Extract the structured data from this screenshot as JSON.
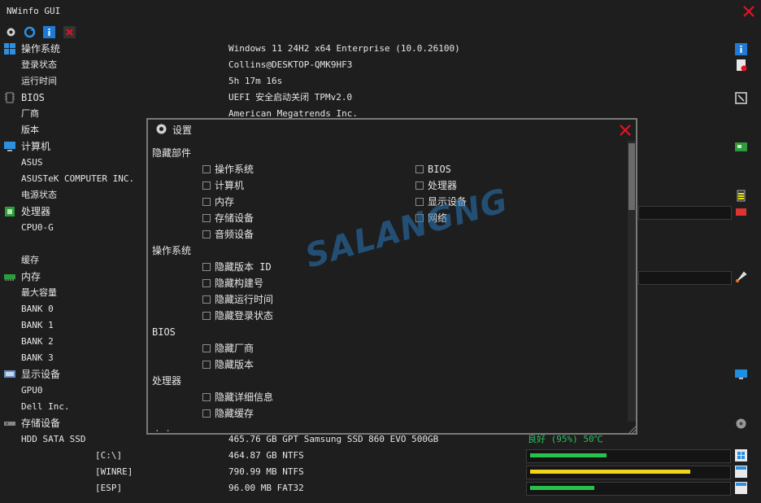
{
  "window": {
    "title": "NWinfo GUI"
  },
  "colors": {
    "background": "#1e1e1e",
    "green": "#27c24c",
    "yellow": "#f2d21b",
    "close_red": "#e81123",
    "good_text": "#25c45a"
  },
  "toolbar": {
    "icons": [
      "settings-icon",
      "refresh-icon",
      "info-icon",
      "exit-icon"
    ]
  },
  "rows": [
    {
      "label": "操作系统",
      "value": "Windows 11 24H2 x64 Enterprise (10.0.26100)",
      "icon": "windows-icon"
    },
    {
      "label": "登录状态",
      "value": "Collins@DESKTOP-QMK9HF3"
    },
    {
      "label": "运行时间",
      "value": "5h 17m 16s"
    },
    {
      "label": "BIOS",
      "value": "UEFI 安全启动关闭 TPMv2.0",
      "icon": "chip-icon"
    },
    {
      "label": "厂商",
      "value": "American Megatrends Inc."
    },
    {
      "label": "版本",
      "value": ""
    },
    {
      "label": "计算机",
      "value": "",
      "icon": "computer-icon"
    },
    {
      "label": "ASUS",
      "value": ""
    },
    {
      "label": "ASUSTeK COMPUTER INC.",
      "value": ""
    },
    {
      "label": "电源状态",
      "value": ""
    },
    {
      "label": "处理器",
      "value": "",
      "icon": "cpu-icon"
    },
    {
      "label": "CPU0-G",
      "value": ""
    },
    {
      "label": "",
      "value": ""
    },
    {
      "label": "缓存",
      "value": ""
    },
    {
      "label": "内存",
      "value": "",
      "icon": "memory-icon"
    },
    {
      "label": "最大容量",
      "value": ""
    },
    {
      "label": "BANK 0",
      "value": ""
    },
    {
      "label": "BANK 1",
      "value": ""
    },
    {
      "label": "BANK 2",
      "value": ""
    },
    {
      "label": "BANK 3",
      "value": ""
    },
    {
      "label": "显示设备",
      "value": "",
      "icon": "display-icon"
    },
    {
      "label": "GPU0",
      "value": ""
    },
    {
      "label": "Dell Inc.",
      "value": ""
    },
    {
      "label": "存储设备",
      "value": "",
      "icon": "storage-icon"
    },
    {
      "label": "HDD SATA SSD",
      "value": "465.76 GB GPT Samsung SSD 860 EVO 500GB",
      "status": "良好 (95%) 50℃"
    }
  ],
  "volumes": [
    {
      "label": "[C:\\]",
      "value": "464.87 GB NTFS",
      "usage": 0.39,
      "color": "#27c24c"
    },
    {
      "label": "[WINRE]",
      "value": "790.99 MB NTFS",
      "usage": 0.82,
      "color": "#f2d21b"
    },
    {
      "label": "[ESP]",
      "value": "96.00 MB FAT32",
      "usage": 0.33,
      "color": "#27c24c"
    }
  ],
  "settings": {
    "title": "设置",
    "sections": [
      {
        "header": "隐藏部件",
        "left": [
          "操作系统",
          "计算机",
          "内存",
          "存储设备",
          "音频设备"
        ],
        "right": [
          "BIOS",
          "处理器",
          "显示设备",
          "网络"
        ]
      },
      {
        "header": "操作系统",
        "left": [
          "隐藏版本 ID",
          "隐藏构建号",
          "隐藏运行时间",
          "隐藏登录状态"
        ],
        "right": []
      },
      {
        "header": "BIOS",
        "left": [
          "隐藏厂商",
          "隐藏版本"
        ],
        "right": []
      },
      {
        "header": "处理器",
        "left": [
          "隐藏详细信息",
          "隐藏缓存"
        ],
        "right": []
      }
    ],
    "more": ". ."
  },
  "watermark": "SALANGNG"
}
